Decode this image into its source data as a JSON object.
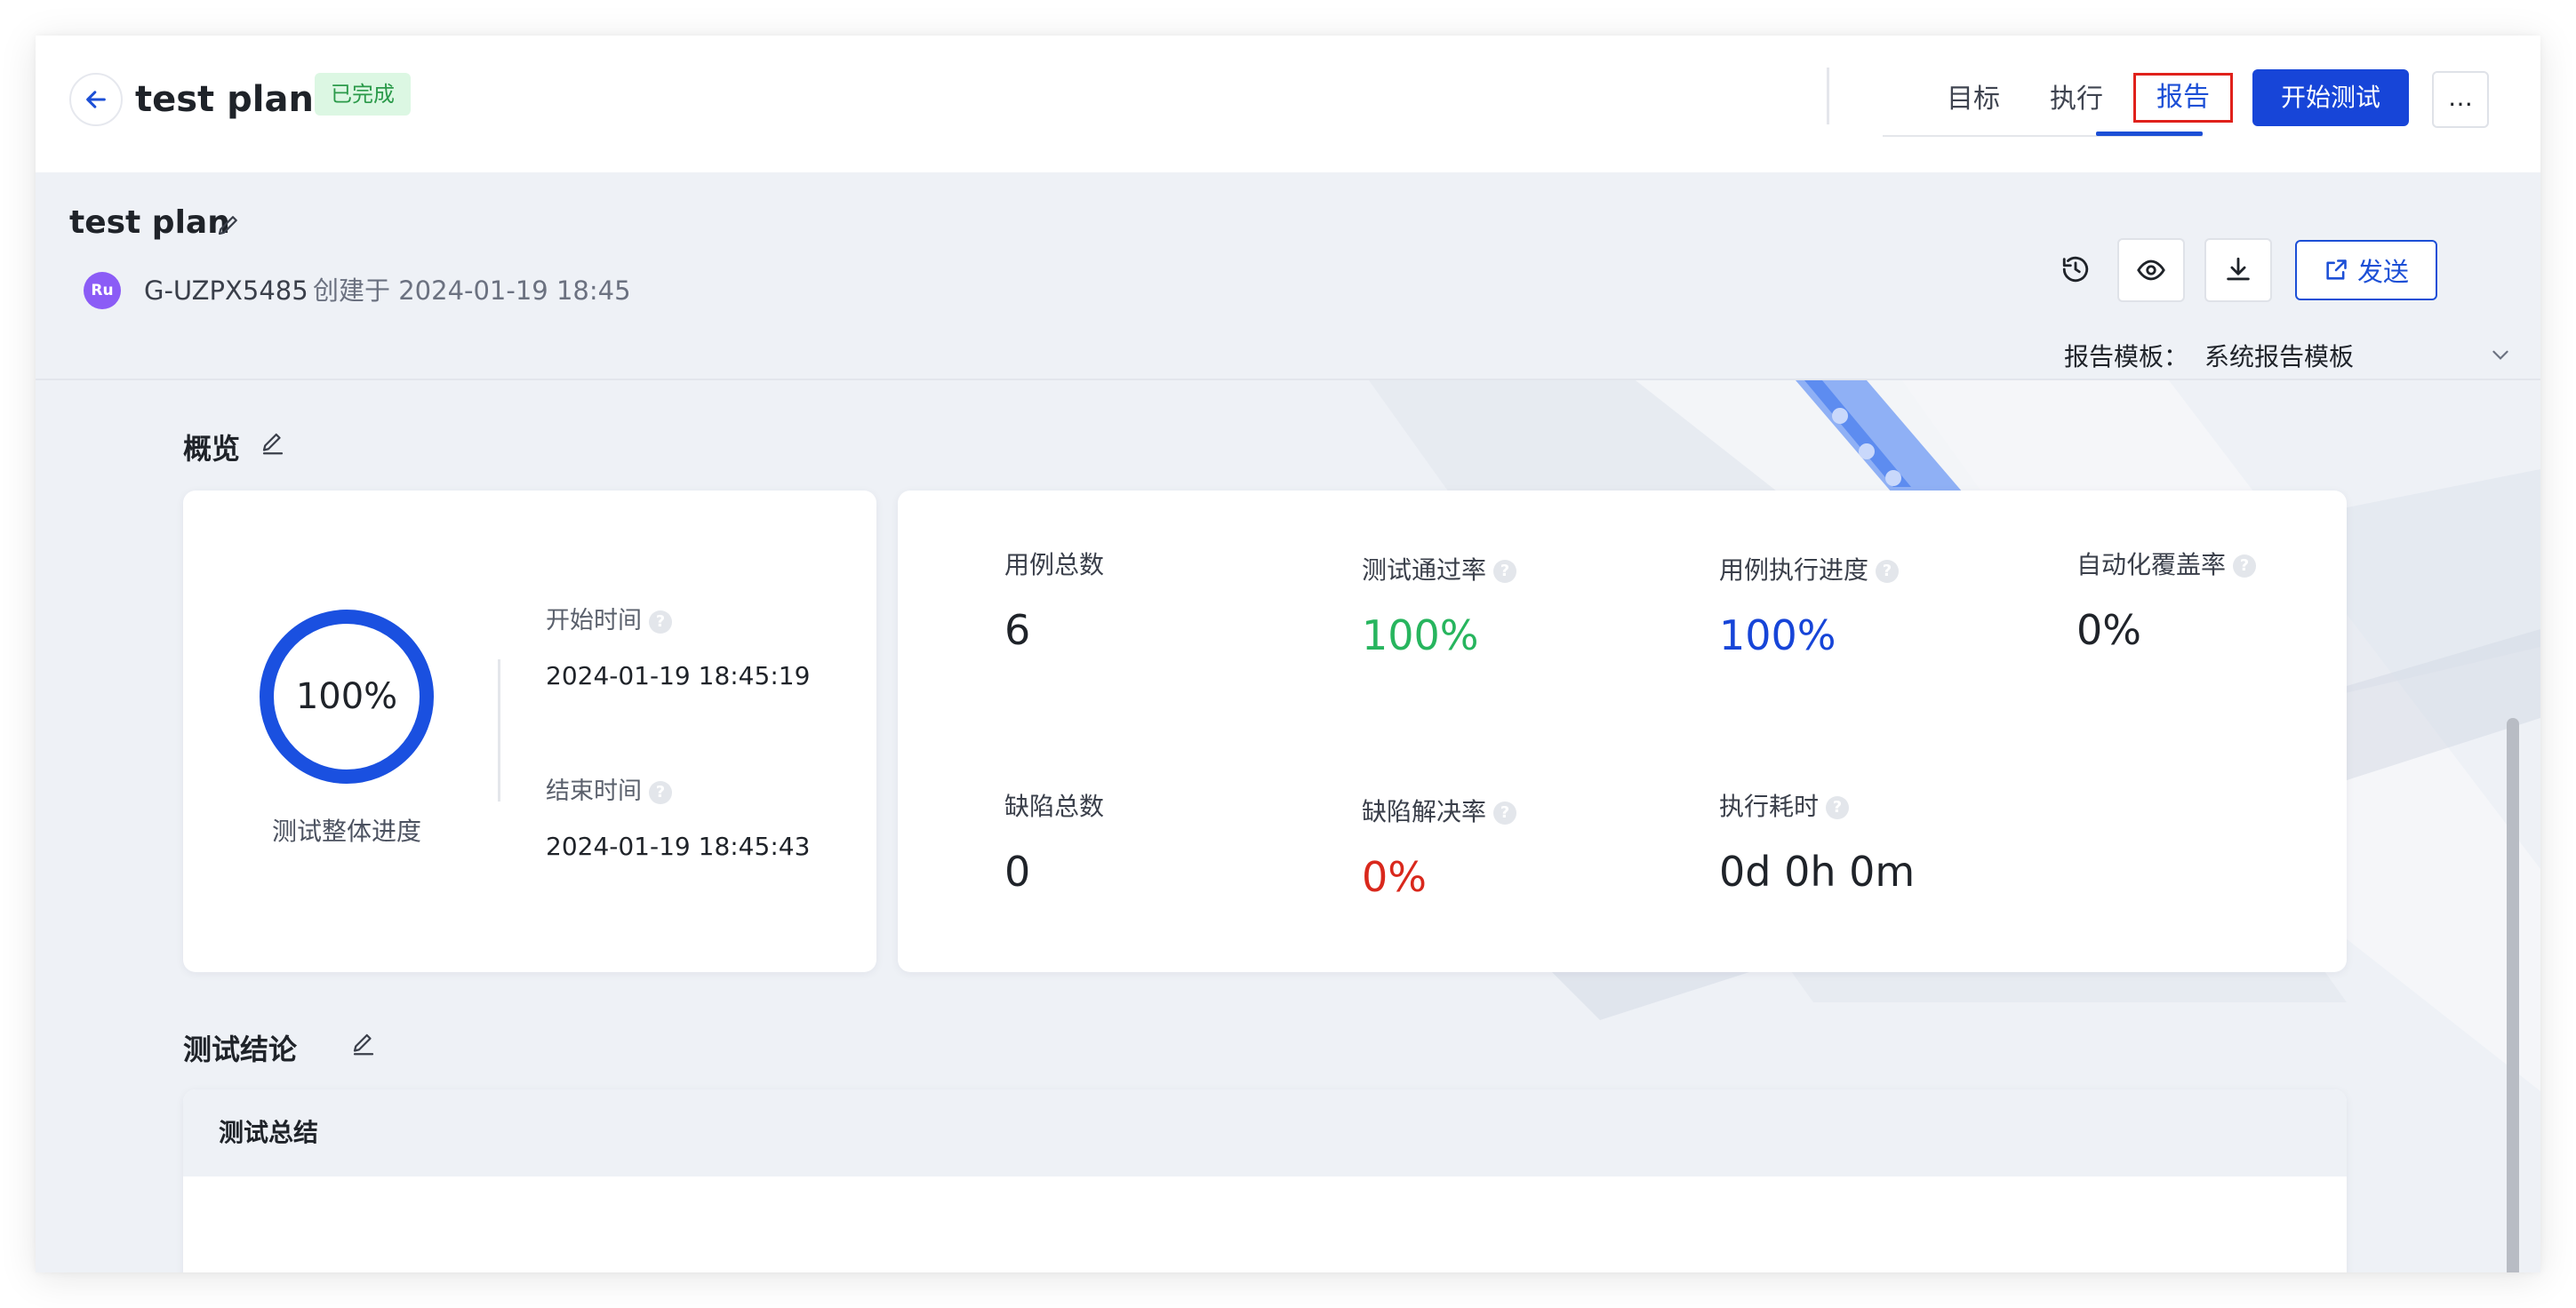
{
  "topbar": {
    "title": "test plan",
    "status": "已完成",
    "tabs": [
      {
        "label": "目标"
      },
      {
        "label": "执行"
      },
      {
        "label": "报告"
      }
    ],
    "start_button": "开始测试",
    "more_button": "…"
  },
  "report": {
    "title": "test plan",
    "avatar_initials": "Ru",
    "creator": "G-UZPX5485",
    "created_text": "创建于 2024-01-19 18:45",
    "send_button": "发送",
    "template_label": "报告模板：",
    "template_value": "系统报告模板"
  },
  "overview": {
    "title": "概览",
    "progress_value": "100%",
    "progress_fraction": 1.0,
    "progress_label": "测试整体进度",
    "start_time_label": "开始时间",
    "start_time": "2024-01-19 18:45:19",
    "end_time_label": "结束时间",
    "end_time": "2024-01-19 18:45:43",
    "metrics": [
      {
        "label": "用例总数",
        "value": "6",
        "help": false,
        "color": "#1f2329"
      },
      {
        "label": "测试通过率",
        "value": "100%",
        "help": true,
        "color": "#27b55e"
      },
      {
        "label": "用例执行进度",
        "value": "100%",
        "help": true,
        "color": "#1745d8"
      },
      {
        "label": "自动化覆盖率",
        "value": "0%",
        "help": true,
        "color": "#1f2329"
      },
      {
        "label": "缺陷总数",
        "value": "0",
        "help": false,
        "color": "#1f2329"
      },
      {
        "label": "缺陷解决率",
        "value": "0%",
        "help": true,
        "color": "#d9281c"
      },
      {
        "label": "执行耗时",
        "value": "0d 0h 0m",
        "help": true,
        "color": "#1f2329"
      }
    ]
  },
  "conclusion": {
    "title": "测试结论",
    "summary_header": "测试总结"
  },
  "colors": {
    "accent": "#1745d8",
    "success_badge_bg": "#dcf7e3",
    "danger": "#d9281c"
  }
}
